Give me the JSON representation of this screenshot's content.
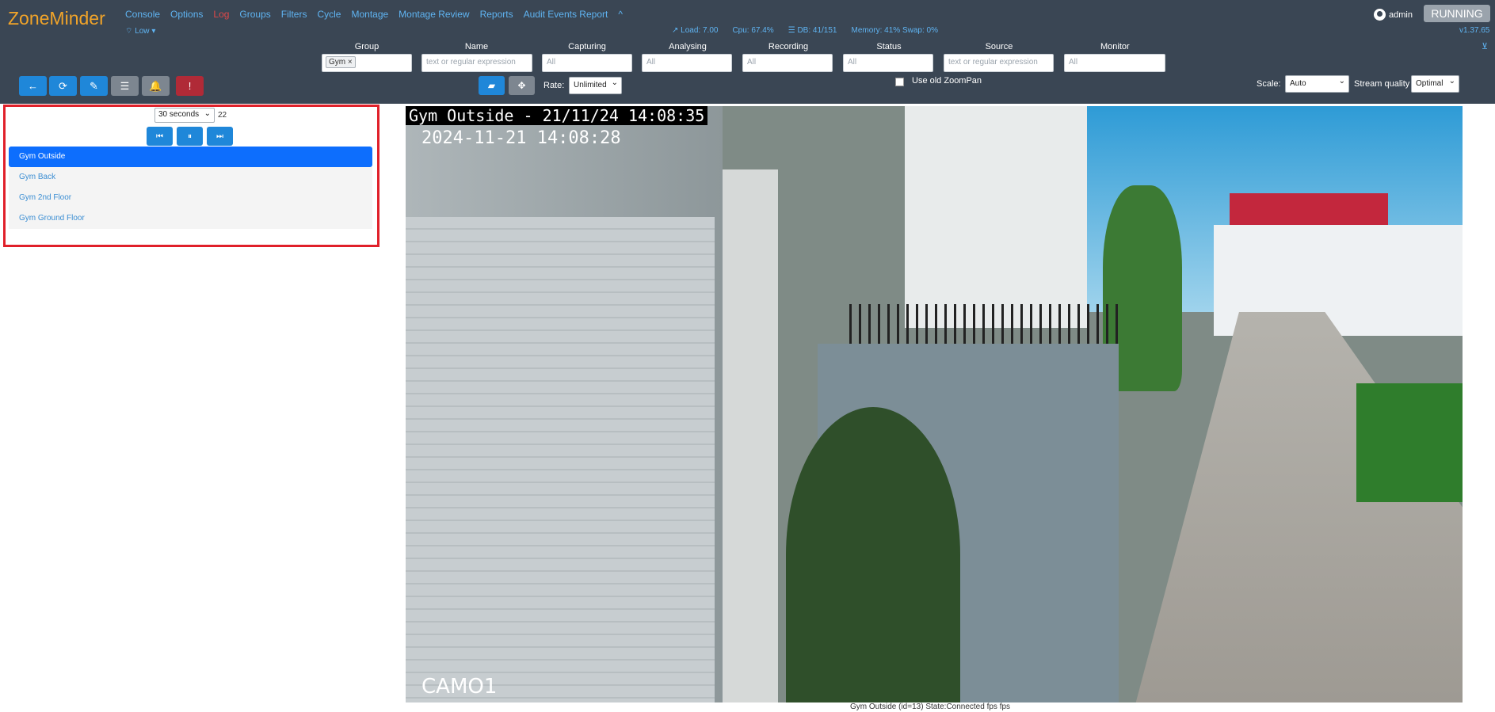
{
  "app": {
    "brand": "ZoneMinder",
    "status_button": "RUNNING",
    "version": "v1.37.65",
    "user": "admin"
  },
  "menu": [
    "Console",
    "Options",
    "Log",
    "Groups",
    "Filters",
    "Cycle",
    "Montage",
    "Montage Review",
    "Reports",
    "Audit Events Report",
    "^"
  ],
  "bandwidth": "Low",
  "stats": {
    "load": "Load: 7.00",
    "cpu": "Cpu: 67.4%",
    "db": "DB: 41/151",
    "memory": "Memory: 41% Swap: 0%"
  },
  "filters": {
    "group": {
      "label": "Group",
      "chip": "Gym ×"
    },
    "name": {
      "label": "Name",
      "placeholder": "text or regular expression"
    },
    "capturing": {
      "label": "Capturing",
      "value": "All"
    },
    "analysing": {
      "label": "Analysing",
      "value": "All"
    },
    "recording": {
      "label": "Recording",
      "value": "All"
    },
    "status": {
      "label": "Status",
      "value": "All"
    },
    "source": {
      "label": "Source",
      "placeholder": "text or regular expression"
    },
    "monitor": {
      "label": "Monitor",
      "value": "All"
    }
  },
  "controls": {
    "rate_label": "Rate:",
    "rate_value": "Unlimited",
    "zoompan_label": "Use old ZoomPan",
    "scale_label": "Scale:",
    "scale_value": "Auto",
    "quality_label": "Stream quality",
    "quality_value": "Optimal"
  },
  "cycle": {
    "interval": "30 seconds",
    "countdown": "22"
  },
  "monitors": [
    "Gym Outside",
    "Gym Back",
    "Gym 2nd Floor",
    "Gym Ground Floor"
  ],
  "stream": {
    "overlay_title": "Gym Outside - 21/11/24 14:08:35",
    "overlay_time": "2024-11-21 14:08:28",
    "overlay_cam": "CAMO1",
    "caption": "Gym Outside (id=13) State:Connected fps fps"
  }
}
